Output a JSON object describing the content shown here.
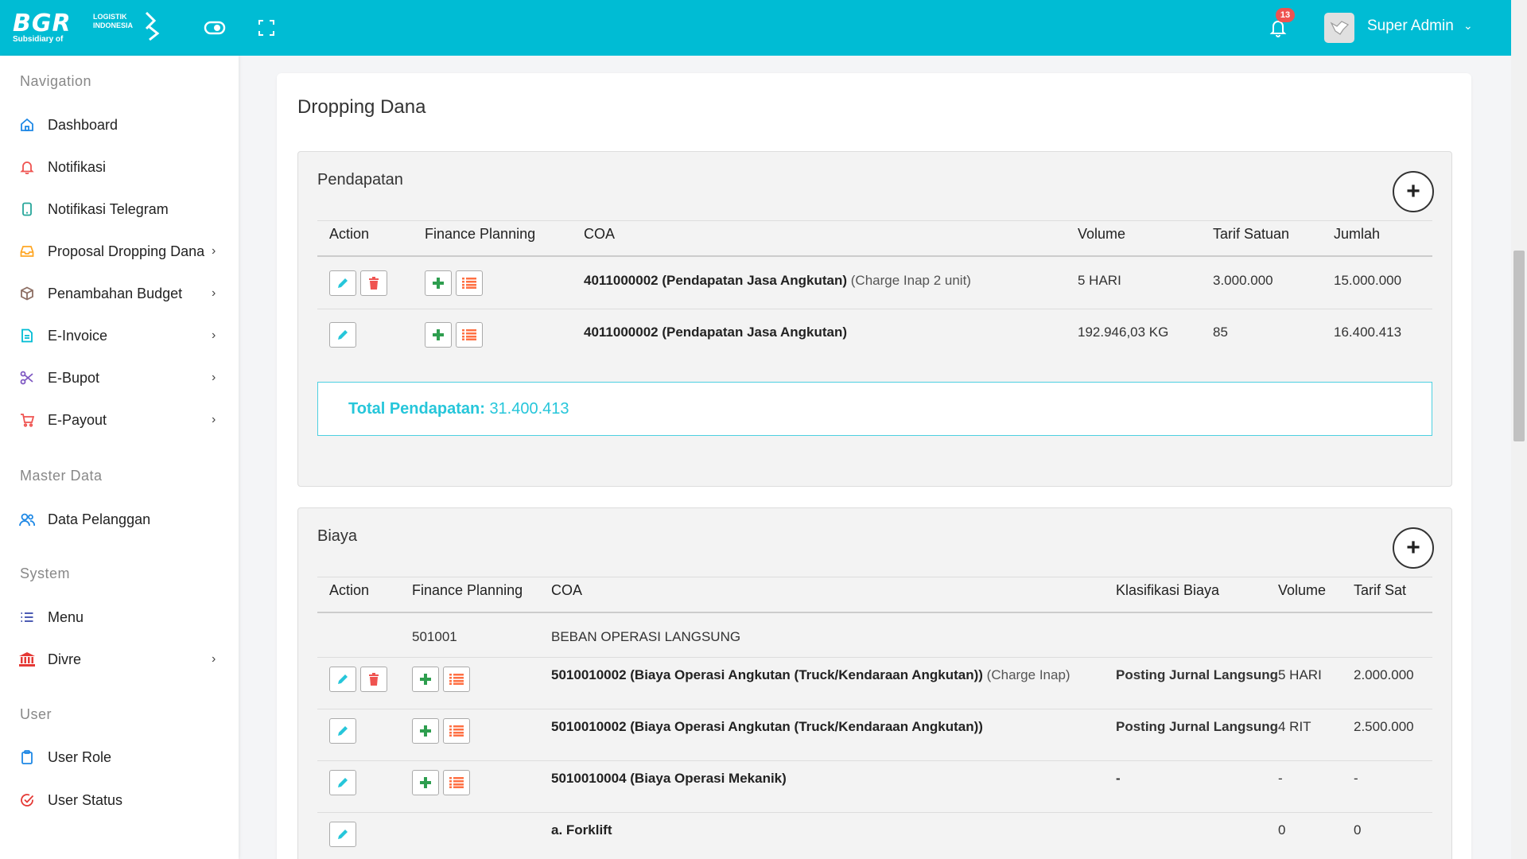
{
  "topbar": {
    "brand": "BGR",
    "brand_sub": "LOGISTIK\nINDONESIA",
    "tagline": "Subsidiary of",
    "notif_count": "13",
    "user_name": "Super Admin",
    "accent": "#00bcd4"
  },
  "sidebar": {
    "sections": [
      {
        "title": "Navigation"
      },
      {
        "title": "Master Data"
      },
      {
        "title": "System"
      },
      {
        "title": "User"
      }
    ],
    "items": [
      {
        "label": "Dashboard",
        "icon": "home-icon"
      },
      {
        "label": "Notifikasi",
        "icon": "bell-icon"
      },
      {
        "label": "Notifikasi Telegram",
        "icon": "phone-icon"
      },
      {
        "label": "Proposal Dropping Dana",
        "icon": "inbox-icon"
      },
      {
        "label": "Penambahan Budget",
        "icon": "box-icon"
      },
      {
        "label": "E-Invoice",
        "icon": "file-icon"
      },
      {
        "label": "E-Bupot",
        "icon": "scissors-icon"
      },
      {
        "label": "E-Payout",
        "icon": "cart-icon"
      },
      {
        "label": "Data Pelanggan",
        "icon": "users-icon"
      },
      {
        "label": "Menu",
        "icon": "list-icon"
      },
      {
        "label": "Divre",
        "icon": "bank-icon"
      },
      {
        "label": "User Role",
        "icon": "clipboard-icon"
      },
      {
        "label": "User Status",
        "icon": "check-circle-icon"
      }
    ]
  },
  "page": {
    "title": "Dropping Dana"
  },
  "pendapatan": {
    "title": "Pendapatan",
    "headers": [
      "Action",
      "Finance Planning",
      "COA",
      "Volume",
      "Tarif Satuan",
      "Jumlah"
    ],
    "rows": [
      {
        "coa": "4011000002 (Pendapatan Jasa Angkutan)",
        "note": "(Charge Inap 2 unit)",
        "volume": "5 HARI",
        "tarif": "3.000.000",
        "jumlah": "15.000.000"
      },
      {
        "coa": "4011000002 (Pendapatan Jasa Angkutan)",
        "note": "",
        "volume": "192.946,03 KG",
        "tarif": "85",
        "jumlah": "16.400.413"
      }
    ],
    "total_label": "Total Pendapatan:",
    "total_value": "31.400.413"
  },
  "biaya": {
    "title": "Biaya",
    "headers": [
      "Action",
      "Finance Planning",
      "COA",
      "Klasifikasi Biaya",
      "Volume",
      "Tarif Sat"
    ],
    "group": {
      "code": "501001",
      "name": "BEBAN OPERASI LANGSUNG"
    },
    "rows": [
      {
        "coa": "5010010002 (Biaya Operasi Angkutan (Truck/Kendaraan Angkutan))",
        "note": "(Charge Inap)",
        "klasifikasi": "Posting Jurnal Langsung",
        "volume": "5 HARI",
        "tarif": "2.000.000"
      },
      {
        "coa": "5010010002 (Biaya Operasi Angkutan (Truck/Kendaraan Angkutan))",
        "note": "",
        "klasifikasi": "Posting Jurnal Langsung",
        "volume": "4 RIT",
        "tarif": "2.500.000"
      },
      {
        "coa": "5010010004 (Biaya Operasi Mekanik)",
        "note": "",
        "klasifikasi": "-",
        "volume": "-",
        "tarif": "-"
      },
      {
        "coa": "a. Forklift",
        "note": "",
        "klasifikasi": "",
        "volume": "0",
        "tarif": "0"
      }
    ]
  }
}
